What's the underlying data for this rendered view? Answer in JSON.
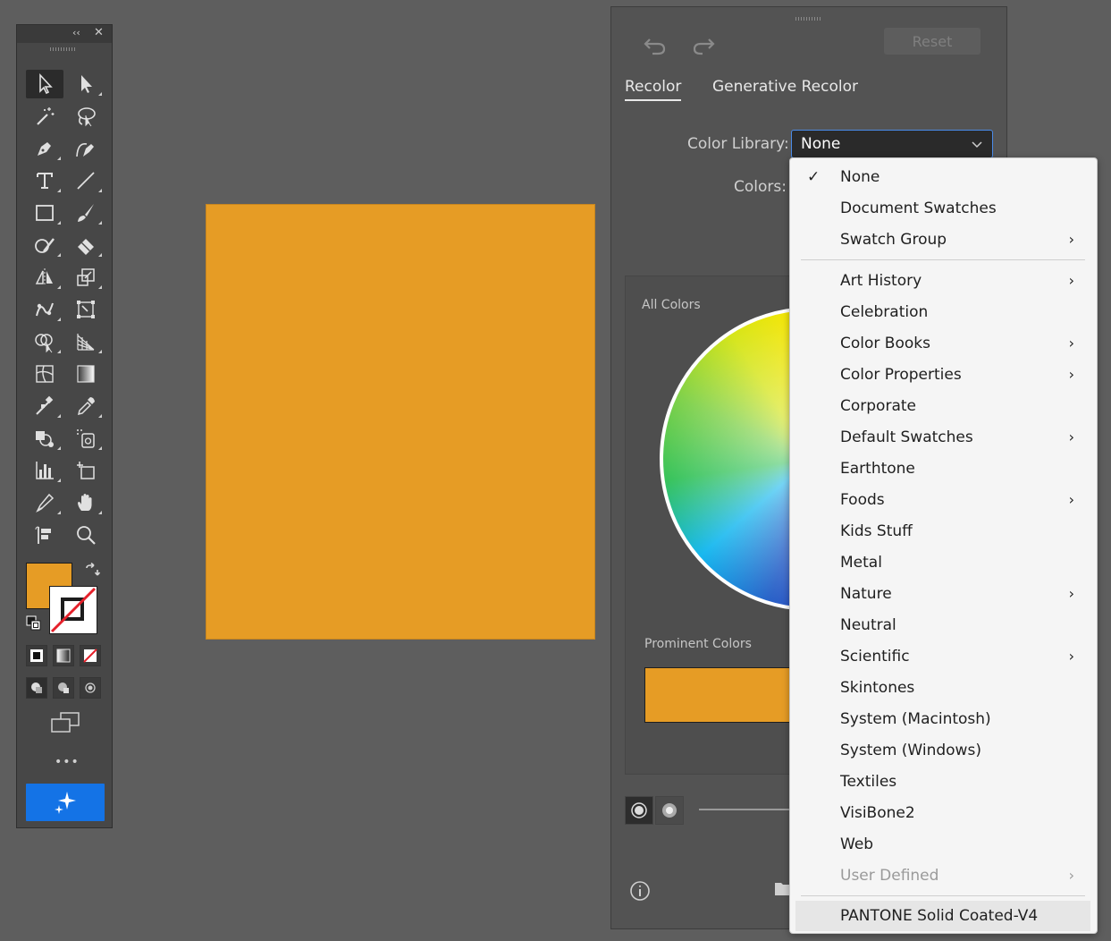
{
  "toolbar": {
    "collapse_glyph": "‹‹",
    "close_glyph": "✕",
    "more_glyph": "•••",
    "fill_color": "#e69c25",
    "tools": [
      "selection-icon",
      "direct-selection-icon",
      "magic-wand-icon",
      "lasso-icon",
      "pen-icon",
      "curvature-icon",
      "type-icon",
      "line-segment-icon",
      "rectangle-icon",
      "paintbrush-icon",
      "shaper-icon",
      "eraser-icon",
      "reflect-icon",
      "scale-icon",
      "puppet-warp-icon",
      "free-transform-icon",
      "shape-builder-icon",
      "perspective-grid-icon",
      "mesh-icon",
      "gradient-icon",
      "blend-icon",
      "eyedropper-icon",
      "symbol-sprayer-icon",
      "live-paint-icon",
      "column-graph-icon",
      "artboard-icon",
      "slice-icon",
      "hand-icon",
      "rotate-view-icon",
      "zoom-icon"
    ]
  },
  "artboard": {
    "fill_color": "#e69c25"
  },
  "panel": {
    "reset_label": "Reset",
    "tabs": [
      "Recolor",
      "Generative Recolor"
    ],
    "color_library_label": "Color Library:",
    "color_library_value": "None",
    "colors_label": "Colors:",
    "all_colors_label": "All Colors",
    "prominent_colors_label": "Prominent Colors",
    "prominent_color": "#e69c25",
    "accent_color": "#1473e6"
  },
  "menu": {
    "items": [
      {
        "label": "None",
        "checked": true,
        "submenu": false
      },
      {
        "label": "Document Swatches",
        "submenu": false
      },
      {
        "label": "Swatch Group",
        "submenu": true
      },
      {
        "label": "Art History",
        "submenu": true
      },
      {
        "label": "Celebration",
        "submenu": false
      },
      {
        "label": "Color Books",
        "submenu": true
      },
      {
        "label": "Color Properties",
        "submenu": true
      },
      {
        "label": "Corporate",
        "submenu": false
      },
      {
        "label": "Default Swatches",
        "submenu": true
      },
      {
        "label": "Earthtone",
        "submenu": false
      },
      {
        "label": "Foods",
        "submenu": true
      },
      {
        "label": "Kids Stuff",
        "submenu": false
      },
      {
        "label": "Metal",
        "submenu": false
      },
      {
        "label": "Nature",
        "submenu": true
      },
      {
        "label": "Neutral",
        "submenu": false
      },
      {
        "label": "Scientific",
        "submenu": true
      },
      {
        "label": "Skintones",
        "submenu": false
      },
      {
        "label": "System (Macintosh)",
        "submenu": false
      },
      {
        "label": "System (Windows)",
        "submenu": false
      },
      {
        "label": "Textiles",
        "submenu": false
      },
      {
        "label": "VisiBone2",
        "submenu": false
      },
      {
        "label": "Web",
        "submenu": false
      },
      {
        "label": "User Defined",
        "submenu": true,
        "disabled": true
      },
      {
        "label": "PANTONE Solid Coated-V4",
        "submenu": false,
        "highlighted": true
      }
    ],
    "check_glyph": "✓",
    "arrow_glyph": "›"
  }
}
